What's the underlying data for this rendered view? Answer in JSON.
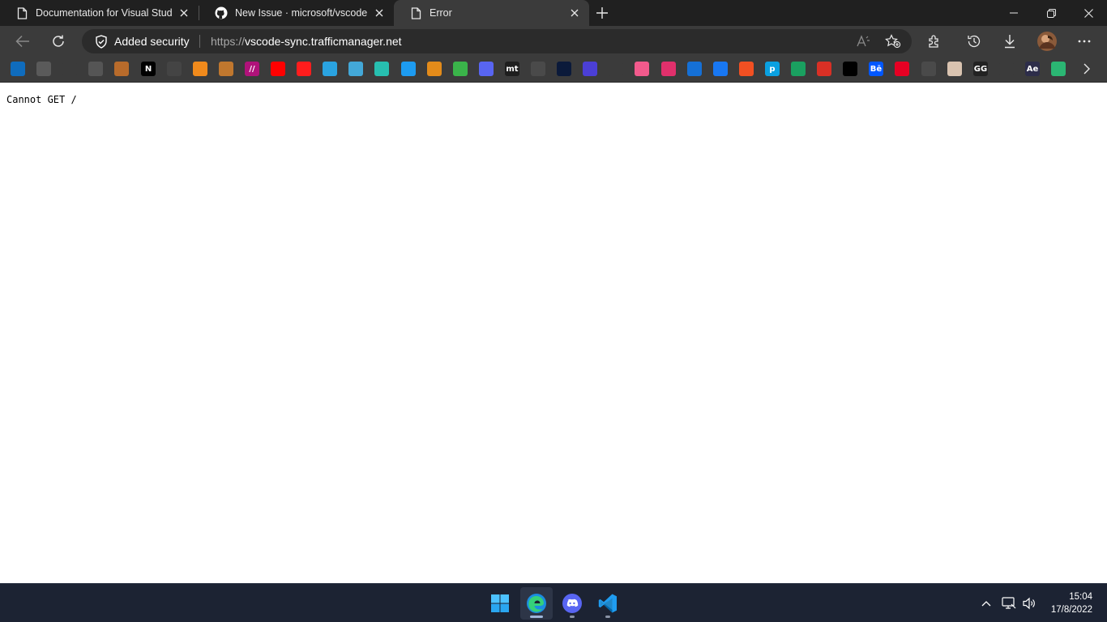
{
  "browser": {
    "tabs": [
      {
        "title": "Documentation for Visual Studio",
        "icon": "page-icon",
        "active": false
      },
      {
        "title": "New Issue · microsoft/vscode",
        "icon": "github-icon",
        "active": false
      },
      {
        "title": "Error",
        "icon": "page-icon",
        "active": true
      }
    ],
    "address": {
      "security_label": "Added security",
      "url_scheme": "https://",
      "url_host": "vscode-sync.trafficmanager.net"
    },
    "favorites": [
      {
        "name": "edge-fav-icon",
        "label": "",
        "color": "#0f6cbd"
      },
      {
        "name": "store-fav-icon",
        "label": "",
        "color": "#5a5a5a"
      },
      {
        "name": "github-fav-icon",
        "label": "",
        "color": "#3b3b3b"
      },
      {
        "name": "stack-fav-icon",
        "label": "",
        "color": "#555555"
      },
      {
        "name": "postman-fav-icon",
        "label": "",
        "color": "#b86b2b"
      },
      {
        "name": "notion-fav-icon",
        "label": "N",
        "color": "#000000"
      },
      {
        "name": "network-fav-icon",
        "label": "",
        "color": "#444444"
      },
      {
        "name": "fire-fav-icon",
        "label": "",
        "color": "#f08a1c"
      },
      {
        "name": "brush-fav-icon",
        "label": "",
        "color": "#c0772e"
      },
      {
        "name": "slashes-fav-icon",
        "label": "//",
        "color": "#b0127a"
      },
      {
        "name": "youtube-fav-icon",
        "label": "",
        "color": "#ff0000"
      },
      {
        "name": "youtube-music-fav-icon",
        "label": "",
        "color": "#ff1d1d"
      },
      {
        "name": "telegram-fav-icon",
        "label": "",
        "color": "#2aa3e0"
      },
      {
        "name": "codepen-fav-icon",
        "label": "",
        "color": "#43a8d8"
      },
      {
        "name": "square-teal-fav-icon",
        "label": "",
        "color": "#27bfb0"
      },
      {
        "name": "twitter-fav-icon",
        "label": "",
        "color": "#1d9bf0"
      },
      {
        "name": "diamond-orange-fav-icon",
        "label": "",
        "color": "#e38b1a"
      },
      {
        "name": "diamond-green-fav-icon",
        "label": "",
        "color": "#3ab44a"
      },
      {
        "name": "discord-fav-icon",
        "label": "",
        "color": "#5865f2"
      },
      {
        "name": "mt-fav-icon",
        "label": "mt",
        "color": "#1e1e1e"
      },
      {
        "name": "shield-fav-icon",
        "label": "",
        "color": "#4a4a4a"
      },
      {
        "name": "code-blue-fav-icon",
        "label": "",
        "color": "#0b1a3a"
      },
      {
        "name": "hexagon-fav-icon",
        "label": "",
        "color": "#4b3fd6"
      },
      {
        "name": "code-fav-icon",
        "label": "",
        "color": "#3b3b3b"
      },
      {
        "name": "diamond-pink-fav-icon",
        "label": "",
        "color": "#f25a8c"
      },
      {
        "name": "instagram-fav-icon",
        "label": "",
        "color": "#e1306c"
      },
      {
        "name": "windows-fav-icon",
        "label": "",
        "color": "#1570d6"
      },
      {
        "name": "facebook-fav-icon",
        "label": "",
        "color": "#1877f2"
      },
      {
        "name": "microsoft-fav-icon",
        "label": "",
        "color": "#f25022"
      },
      {
        "name": "p-fav-icon",
        "label": "p",
        "color": "#0aa0e0"
      },
      {
        "name": "photo-fav-icon",
        "label": "",
        "color": "#1aa060"
      },
      {
        "name": "gmail-fav-icon",
        "label": "",
        "color": "#d93025"
      },
      {
        "name": "unsplash-fav-icon",
        "label": "",
        "color": "#000000"
      },
      {
        "name": "behance-fav-icon",
        "label": "Bē",
        "color": "#0057ff"
      },
      {
        "name": "pinterest-fav-icon",
        "label": "",
        "color": "#e60023"
      },
      {
        "name": "gray-square-fav-icon",
        "label": "",
        "color": "#4a4a4a"
      },
      {
        "name": "anime-fav-icon",
        "label": "",
        "color": "#d9c3b0"
      },
      {
        "name": "gg-fav-icon",
        "label": "GG",
        "color": "#222222"
      },
      {
        "name": "doc-fav-icon",
        "label": "",
        "color": "#3b3b3b"
      },
      {
        "name": "ae-fav-icon",
        "label": "Ae",
        "color": "#2d2d4a"
      },
      {
        "name": "play-fav-icon",
        "label": "",
        "color": "#2bb673"
      }
    ]
  },
  "page": {
    "error_text": "Cannot GET /"
  },
  "taskbar": {
    "apps": [
      {
        "name": "windows-start-icon"
      },
      {
        "name": "edge-taskbar-icon",
        "active": true
      },
      {
        "name": "discord-taskbar-icon"
      },
      {
        "name": "vscode-taskbar-icon"
      }
    ],
    "time": "15:04",
    "date": "17/8/2022"
  }
}
